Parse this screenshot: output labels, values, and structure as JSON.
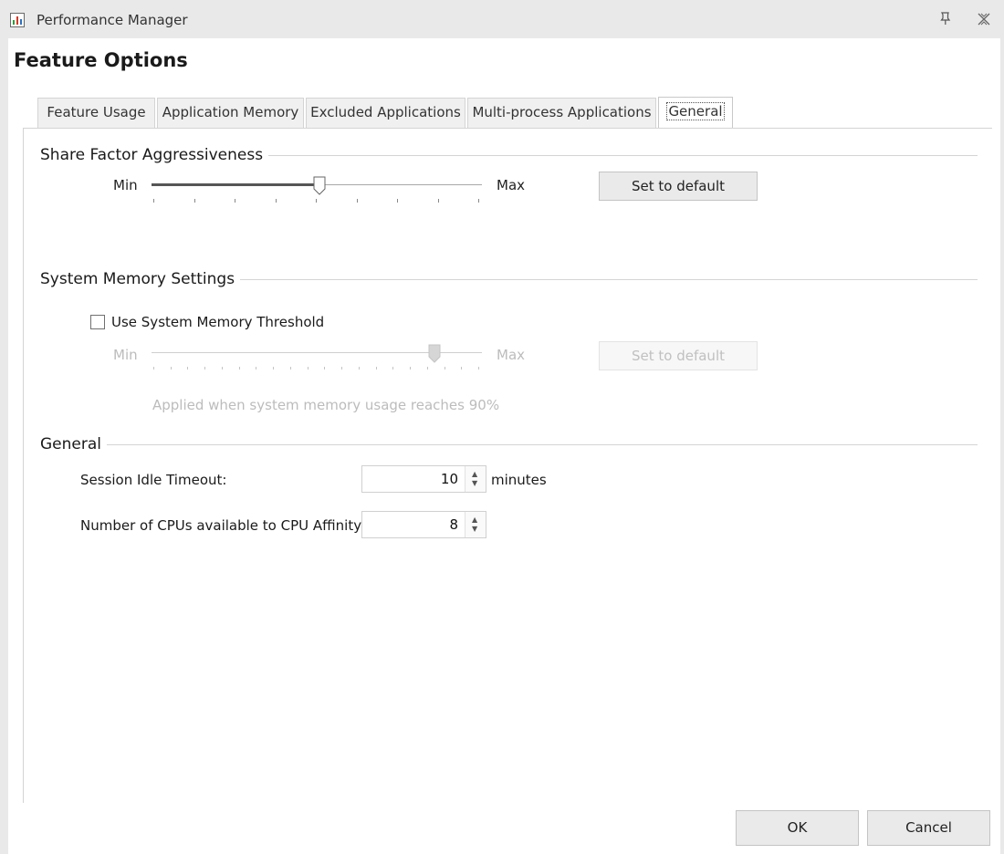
{
  "window": {
    "title": "Performance Manager",
    "pin_icon": "pin-icon",
    "close_icon": "close-icon"
  },
  "heading": "Feature Options",
  "tabs": [
    {
      "label": "Feature Usage",
      "active": false
    },
    {
      "label": "Application Memory",
      "active": false
    },
    {
      "label": "Excluded Applications",
      "active": false
    },
    {
      "label": "Multi-process Applications",
      "active": false
    },
    {
      "label": "General",
      "active": true
    }
  ],
  "share_factor": {
    "title": "Share Factor Aggressiveness",
    "min_label": "Min",
    "max_label": "Max",
    "value_fraction": 0.5,
    "default_button": "Set to default"
  },
  "system_memory": {
    "title": "System Memory Settings",
    "checkbox_label": "Use System Memory Threshold",
    "checked": false,
    "min_label": "Min",
    "max_label": "Max",
    "value_fraction": 0.9,
    "default_button": "Set to default",
    "note": "Applied when system memory usage reaches 90%"
  },
  "general": {
    "title": "General",
    "session_idle": {
      "label": "Session Idle Timeout:",
      "value": "10",
      "unit": "minutes"
    },
    "cpu_count": {
      "label": "Number of CPUs available to CPU Affinity:",
      "value": "8"
    }
  },
  "footer": {
    "ok": "OK",
    "cancel": "Cancel"
  }
}
